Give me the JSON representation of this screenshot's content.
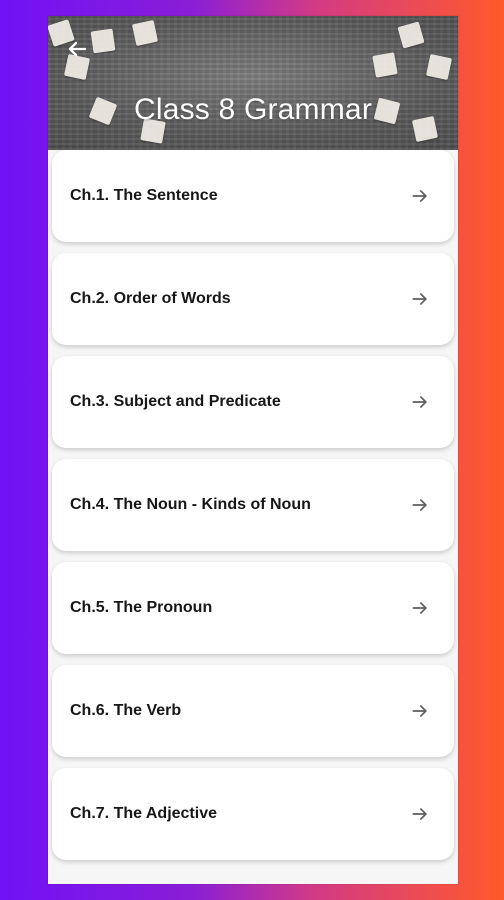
{
  "header": {
    "title": "Class 8 Grammar"
  },
  "chapters": [
    {
      "label": "Ch.1. The Sentence"
    },
    {
      "label": "Ch.2. Order of Words"
    },
    {
      "label": "Ch.3. Subject and Predicate"
    },
    {
      "label": "Ch.4. The Noun - Kinds of Noun"
    },
    {
      "label": "Ch.5. The Pronoun"
    },
    {
      "label": "Ch.6. The Verb"
    },
    {
      "label": "Ch.7. The Adjective"
    }
  ],
  "icons": {
    "back": "arrow-left-icon",
    "chapter_arrow": "arrow-right-icon"
  },
  "colors": {
    "background_left": "#6f12f6",
    "background_right": "#ff5a2a",
    "card": "#ffffff",
    "text": "#171717",
    "title": "#ffffff"
  }
}
